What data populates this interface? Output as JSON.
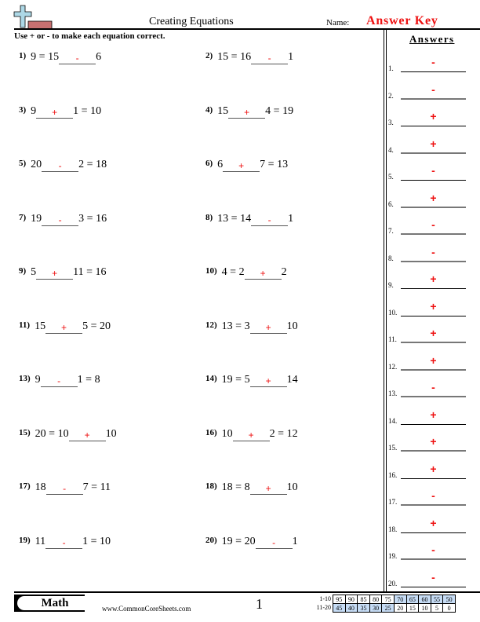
{
  "header": {
    "title": "Creating Equations",
    "name_label": "Name:",
    "name_value": "Answer Key",
    "instructions": "Use + or - to make each equation correct.",
    "logo_icon": "plus-minus-logo-icon"
  },
  "colors": {
    "answer_red": "#ee1111",
    "score_highlight": "#c6dcf5",
    "logo_plus": "#add8e6",
    "logo_minus": "#c87070"
  },
  "problems": [
    {
      "n": "1)",
      "left": "9 = 15",
      "answer": "-",
      "right": "6"
    },
    {
      "n": "2)",
      "left": "15 = 16",
      "answer": "-",
      "right": "1"
    },
    {
      "n": "3)",
      "left": "9",
      "answer": "+",
      "right": "1 = 10"
    },
    {
      "n": "4)",
      "left": "15",
      "answer": "+",
      "right": "4 = 19"
    },
    {
      "n": "5)",
      "left": "20",
      "answer": "-",
      "right": "2 = 18"
    },
    {
      "n": "6)",
      "left": "6",
      "answer": "+",
      "right": "7 = 13"
    },
    {
      "n": "7)",
      "left": "19",
      "answer": "-",
      "right": "3 = 16"
    },
    {
      "n": "8)",
      "left": "13 = 14",
      "answer": "-",
      "right": "1"
    },
    {
      "n": "9)",
      "left": "5",
      "answer": "+",
      "right": "11 = 16"
    },
    {
      "n": "10)",
      "left": "4 = 2",
      "answer": "+",
      "right": "2"
    },
    {
      "n": "11)",
      "left": "15",
      "answer": "+",
      "right": "5 = 20"
    },
    {
      "n": "12)",
      "left": "13 = 3",
      "answer": "+",
      "right": "10"
    },
    {
      "n": "13)",
      "left": "9",
      "answer": "-",
      "right": "1 = 8"
    },
    {
      "n": "14)",
      "left": "19 = 5",
      "answer": "+",
      "right": "14"
    },
    {
      "n": "15)",
      "left": "20 = 10",
      "answer": "+",
      "right": "10"
    },
    {
      "n": "16)",
      "left": "10",
      "answer": "+",
      "right": "2 = 12"
    },
    {
      "n": "17)",
      "left": "18",
      "answer": "-",
      "right": "7 = 11"
    },
    {
      "n": "18)",
      "left": "18 = 8",
      "answer": "+",
      "right": "10"
    },
    {
      "n": "19)",
      "left": "11",
      "answer": "-",
      "right": "1 = 10"
    },
    {
      "n": "20)",
      "left": "19 = 20",
      "answer": "-",
      "right": "1"
    }
  ],
  "answers": {
    "heading": "Answers",
    "items": [
      {
        "n": "1.",
        "value": "-"
      },
      {
        "n": "2.",
        "value": "-"
      },
      {
        "n": "3.",
        "value": "+"
      },
      {
        "n": "4.",
        "value": "+"
      },
      {
        "n": "5.",
        "value": "-"
      },
      {
        "n": "6.",
        "value": "+"
      },
      {
        "n": "7.",
        "value": "-"
      },
      {
        "n": "8.",
        "value": "-"
      },
      {
        "n": "9.",
        "value": "+"
      },
      {
        "n": "10.",
        "value": "+"
      },
      {
        "n": "11.",
        "value": "+"
      },
      {
        "n": "12.",
        "value": "+"
      },
      {
        "n": "13.",
        "value": "-"
      },
      {
        "n": "14.",
        "value": "+"
      },
      {
        "n": "15.",
        "value": "+"
      },
      {
        "n": "16.",
        "value": "+"
      },
      {
        "n": "17.",
        "value": "-"
      },
      {
        "n": "18.",
        "value": "+"
      },
      {
        "n": "19.",
        "value": "-"
      },
      {
        "n": "20.",
        "value": "-"
      }
    ]
  },
  "footer": {
    "subject": "Math",
    "website": "www.CommonCoreSheets.com",
    "page_number": "1",
    "score_rows": [
      {
        "label": "1-10",
        "values": [
          "95",
          "90",
          "85",
          "80",
          "75",
          "70",
          "65",
          "60",
          "55",
          "50"
        ],
        "highlight": [
          false,
          false,
          false,
          false,
          false,
          true,
          true,
          true,
          true,
          true
        ]
      },
      {
        "label": "11-20",
        "values": [
          "45",
          "40",
          "35",
          "30",
          "25",
          "20",
          "15",
          "10",
          "5",
          "0"
        ],
        "highlight": [
          true,
          true,
          true,
          true,
          true,
          false,
          false,
          false,
          false,
          false
        ]
      }
    ]
  }
}
